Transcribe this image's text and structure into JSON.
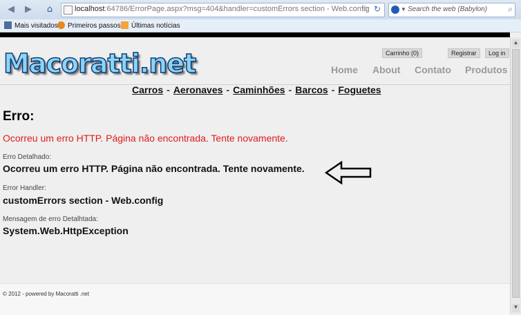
{
  "browser": {
    "url_host": "localhost",
    "url_rest": ":64786/ErrorPage.aspx?msg=404&handler=customErrors section - Web.config",
    "search_placeholder": "Search the web (Babylon)",
    "bookmarks": [
      "Mais visitados",
      "Primeiros passos",
      "Últimas notícias"
    ]
  },
  "site": {
    "logo": "Macoratti.net",
    "util_links": [
      "Carrinho (0)",
      "Registrar",
      "Log in"
    ],
    "menu": [
      "Home",
      "About",
      "Contato",
      "Produtos"
    ],
    "categories": [
      "Carros",
      "Aeronaves",
      "Caminhões",
      "Barcos",
      "Foguetes"
    ],
    "category_separator": "-"
  },
  "error": {
    "title": "Erro:",
    "message": "Ocorreu um erro HTTP. Página não encontrada. Tente novamente.",
    "detail_label": "Erro Detalhado:",
    "detail_value": "Ocorreu um erro HTTP. Página não encontrada. Tente novamente.",
    "handler_label": "Error Handler:",
    "handler_value": "customErrors section - Web.config",
    "exception_label": "Mensagem de erro Detalhtada:",
    "exception_value": "System.Web.HttpException"
  },
  "footer": {
    "text": "© 2012 - powered by Macoratti .net"
  },
  "icons": {
    "back": "back-arrow-icon",
    "forward": "forward-arrow-icon",
    "home": "home-icon",
    "star": "star-icon",
    "reload": "reload-icon",
    "search": "magnifier-icon",
    "annotation": "left-arrow-icon"
  },
  "colors": {
    "error_red": "#e01b1b",
    "menu_gray": "#999999",
    "logo_blue": "#8bd4f5"
  }
}
